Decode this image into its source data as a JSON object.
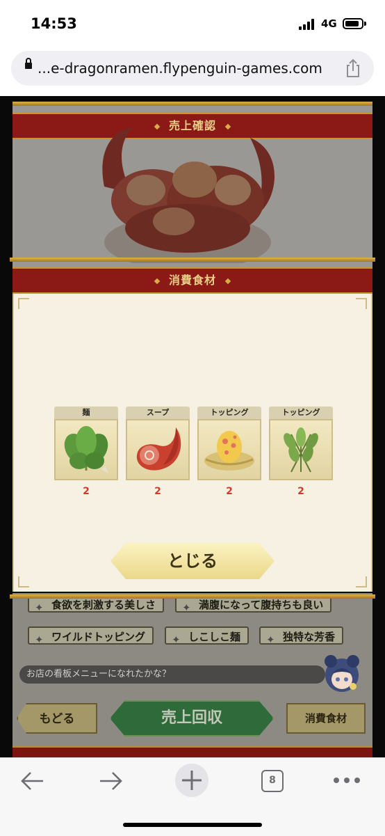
{
  "status_bar": {
    "time": "14:53",
    "network": "4G"
  },
  "browser": {
    "url": "...e-dragonramen.flypenguin-games.com",
    "tab_count": "8",
    "icons": [
      "lock-icon",
      "share-icon",
      "back-arrow-icon",
      "forward-arrow-icon",
      "new-tab-plus-icon",
      "tabs-icon",
      "more-icon"
    ]
  },
  "game": {
    "top_banner": "売上確認",
    "traits": [
      "食欲を刺激する美しさ",
      "満腹になって腹持ちも良い",
      "ワイルドトッピング",
      "しこしこ麺",
      "独特な芳香"
    ],
    "message": "お店の看板メニューになれたかな？",
    "buttons": {
      "back": "もどる",
      "collect": "売上回収",
      "ingredients": "消費食材"
    }
  },
  "modal": {
    "title": "消費食材",
    "close_label": "とじる",
    "items": [
      {
        "category": "麺",
        "icon": "leafy-greens-icon",
        "count": "2"
      },
      {
        "category": "スープ",
        "icon": "meat-icon",
        "count": "2"
      },
      {
        "category": "トッピング",
        "icon": "spotted-egg-nest-icon",
        "count": "2"
      },
      {
        "category": "トッピング",
        "icon": "herb-bundle-icon",
        "count": "2"
      }
    ]
  },
  "colors": {
    "banner_red": "#8b1a17",
    "gold": "#d9ad45",
    "count_red": "#d2392c",
    "green_button": "#2f6b3a"
  }
}
